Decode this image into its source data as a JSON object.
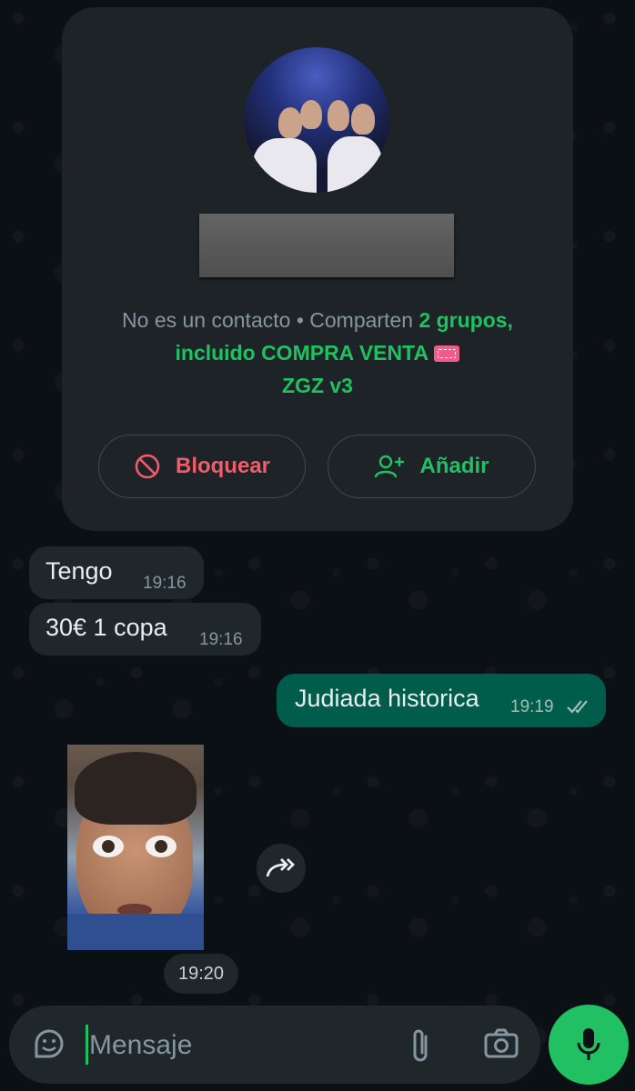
{
  "contact_card": {
    "info_prefix": "No es un contacto • Comparten ",
    "info_groups": "2 grupos, incluido COMPRA VENTA",
    "info_group_suffix": "ZGZ v3",
    "block_label": "Bloquear",
    "add_label": "Añadir"
  },
  "messages": [
    {
      "text": "Tengo",
      "time": "19:16",
      "direction": "in"
    },
    {
      "text": "30€ 1 copa",
      "time": "19:16",
      "direction": "in"
    },
    {
      "text": "Judiada historica",
      "time": "19:19",
      "direction": "out",
      "status": "read"
    }
  ],
  "photo_message": {
    "time": "19:20"
  },
  "composer": {
    "placeholder": "Mensaje"
  },
  "colors": {
    "accent": "#21c063",
    "outgoing_bubble": "#005c4b",
    "incoming_bubble": "#1f272a",
    "danger": "#f15c6d"
  }
}
